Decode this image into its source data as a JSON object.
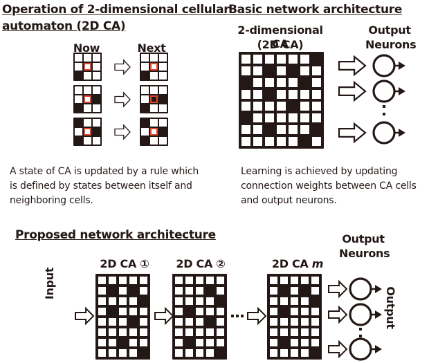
{
  "top_left": {
    "title": "Operation of 2-dimensional  cellular automaton (2D CA)",
    "title_line1": "Operation of 2-dimensional  cellular",
    "title_line2": "automaton (2D CA)",
    "now_label": "Now",
    "next_label": "Next",
    "highlight_color": "#e0452e",
    "examples": [
      {
        "now": [
          [
            1,
            1,
            1
          ],
          [
            1,
            1,
            1
          ],
          [
            0,
            1,
            1
          ]
        ],
        "next": [
          [
            1,
            1,
            1
          ],
          [
            1,
            1,
            1
          ],
          [
            0,
            1,
            1
          ]
        ]
      },
      {
        "now": [
          [
            1,
            1,
            1
          ],
          [
            1,
            1,
            0
          ],
          [
            0,
            1,
            1
          ]
        ],
        "next": [
          [
            1,
            1,
            1
          ],
          [
            1,
            0,
            0
          ],
          [
            0,
            1,
            1
          ]
        ]
      },
      {
        "now": [
          [
            0,
            1,
            1
          ],
          [
            1,
            1,
            0
          ],
          [
            0,
            1,
            1
          ]
        ],
        "next": [
          [
            0,
            1,
            1
          ],
          [
            1,
            1,
            0
          ],
          [
            0,
            1,
            1
          ]
        ]
      }
    ],
    "description_lines": [
      "A state of CA is updated by a rule which",
      "is defined by states between itself and",
      "neighboring cells."
    ]
  },
  "top_right": {
    "title": "Basic network architecture",
    "ca_label_line1": "2-dimensional CA",
    "ca_label_line2": "(2D CA)",
    "output_label_line1": "Output",
    "output_label_line2": "Neurons",
    "grid": [
      [
        1,
        1,
        1,
        1,
        1,
        1,
        0
      ],
      [
        1,
        1,
        0,
        1,
        0,
        1,
        1
      ],
      [
        0,
        1,
        1,
        1,
        1,
        0,
        1
      ],
      [
        1,
        1,
        0,
        1,
        1,
        1,
        1
      ],
      [
        1,
        1,
        1,
        1,
        0,
        1,
        1
      ],
      [
        0,
        1,
        1,
        1,
        1,
        1,
        1
      ],
      [
        1,
        1,
        0,
        1,
        1,
        1,
        0
      ],
      [
        1,
        1,
        1,
        1,
        1,
        0,
        1
      ]
    ],
    "description_lines": [
      "Learning is achieved by updating",
      "connection weights between CA cells",
      "and output neurons."
    ]
  },
  "bottom": {
    "title": "Proposed network architecture",
    "input_label": "Input",
    "output_label": "Output",
    "output_neurons_line1": "Output",
    "output_neurons_line2": "Neurons",
    "ellipsis": "⋯",
    "layers": [
      {
        "label": "2D CA ①",
        "grid": [
          [
            1,
            1,
            1,
            1,
            1
          ],
          [
            1,
            0,
            1,
            0,
            1
          ],
          [
            1,
            1,
            1,
            1,
            0
          ],
          [
            1,
            0,
            1,
            1,
            1
          ],
          [
            1,
            1,
            1,
            0,
            1
          ],
          [
            1,
            1,
            1,
            1,
            1
          ],
          [
            1,
            1,
            0,
            1,
            1
          ],
          [
            1,
            1,
            1,
            1,
            0
          ]
        ]
      },
      {
        "label": "2D CA ②",
        "grid": [
          [
            1,
            1,
            1,
            1,
            1
          ],
          [
            1,
            1,
            1,
            0,
            1
          ],
          [
            1,
            1,
            1,
            1,
            0
          ],
          [
            1,
            0,
            1,
            1,
            1
          ],
          [
            1,
            1,
            1,
            0,
            1
          ],
          [
            1,
            1,
            1,
            1,
            1
          ],
          [
            1,
            0,
            1,
            1,
            1
          ],
          [
            1,
            1,
            1,
            1,
            0
          ]
        ]
      },
      {
        "label_prefix": "2D CA ",
        "label_suffix": "m",
        "grid": [
          [
            1,
            1,
            1,
            1,
            1
          ],
          [
            1,
            0,
            1,
            0,
            1
          ],
          [
            1,
            1,
            1,
            1,
            0
          ],
          [
            1,
            0,
            1,
            1,
            1
          ],
          [
            1,
            1,
            1,
            1,
            1
          ],
          [
            1,
            1,
            1,
            1,
            1
          ],
          [
            1,
            0,
            1,
            1,
            1
          ],
          [
            1,
            1,
            1,
            1,
            0
          ]
        ]
      }
    ]
  }
}
